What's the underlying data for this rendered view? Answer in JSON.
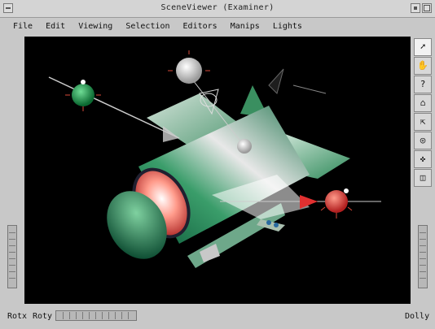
{
  "window": {
    "title": "SceneViewer (Examiner)"
  },
  "menubar": {
    "items": [
      "File",
      "Edit",
      "Viewing",
      "Selection",
      "Editors",
      "Manips",
      "Lights"
    ]
  },
  "right_toolbar": {
    "buttons": [
      {
        "icon": "pick-arrow-icon",
        "glyph": "➚",
        "active": true
      },
      {
        "icon": "view-hand-icon",
        "glyph": "✋",
        "active": false
      },
      {
        "icon": "help-icon",
        "glyph": "?",
        "active": false
      },
      {
        "icon": "home-icon",
        "glyph": "⌂",
        "active": false
      },
      {
        "icon": "set-home-icon",
        "glyph": "⇱",
        "active": false
      },
      {
        "icon": "view-all-icon",
        "glyph": "◎",
        "active": false
      },
      {
        "icon": "seek-icon",
        "glyph": "✜",
        "active": false
      },
      {
        "icon": "camera-type-icon",
        "glyph": "◫",
        "active": false
      }
    ]
  },
  "bottom_bar": {
    "rotx_label": "Rotx",
    "roty_label": "Roty",
    "dolly_label": "Dolly"
  },
  "colors": {
    "viewport_background": "#000000",
    "chrome": "#c8c8c8"
  }
}
